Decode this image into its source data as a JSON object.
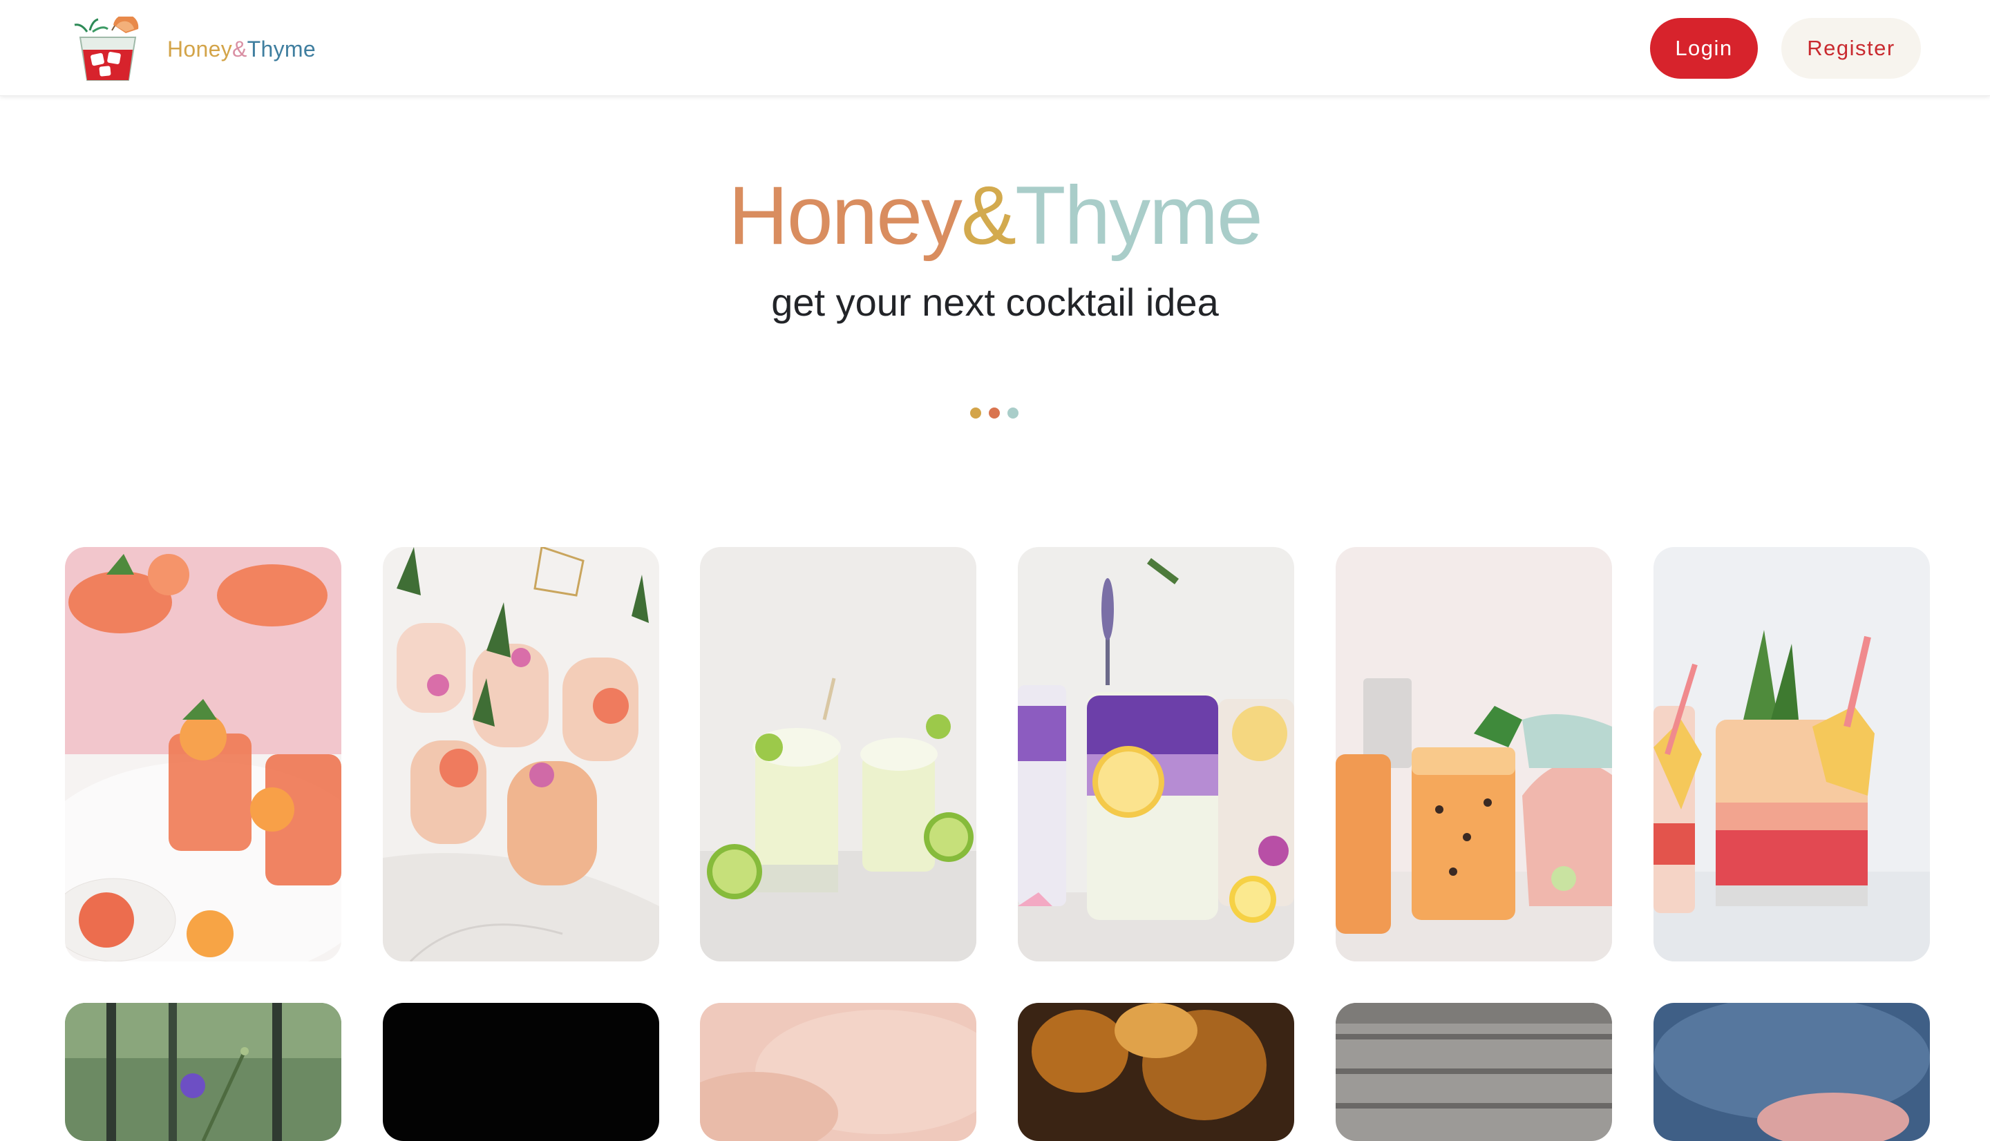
{
  "brand": {
    "name_part1": "Honey",
    "name_amp": "&",
    "name_part2": "Thyme"
  },
  "nav": {
    "login_label": "Login",
    "register_label": "Register"
  },
  "hero": {
    "title_part1": "Honey",
    "title_amp": "&",
    "title_part2": "Thyme",
    "subtitle": "get your next cocktail idea"
  },
  "colors": {
    "accent_red": "#d7232c",
    "honey": "#d98d5f",
    "amp": "#d3aa4e",
    "thyme": "#a9cdc9",
    "loader_dots": [
      "#d3a449",
      "#d9744f",
      "#a9cdc9"
    ]
  },
  "gallery": {
    "items": [
      {
        "alt": "grapefruit-slush-cocktails"
      },
      {
        "alt": "grapefruit-flower-cocktails"
      },
      {
        "alt": "frozen-lime-margaritas"
      },
      {
        "alt": "butterfly-pea-lemonade"
      },
      {
        "alt": "passion-fruit-cocktails"
      },
      {
        "alt": "pineapple-layered-cocktail"
      },
      {
        "alt": "garden-cocktail"
      },
      {
        "alt": "dark-cocktail"
      },
      {
        "alt": "pink-cocktail"
      },
      {
        "alt": "amber-cocktail"
      },
      {
        "alt": "rustic-cocktail"
      },
      {
        "alt": "blue-cocktail"
      }
    ]
  }
}
